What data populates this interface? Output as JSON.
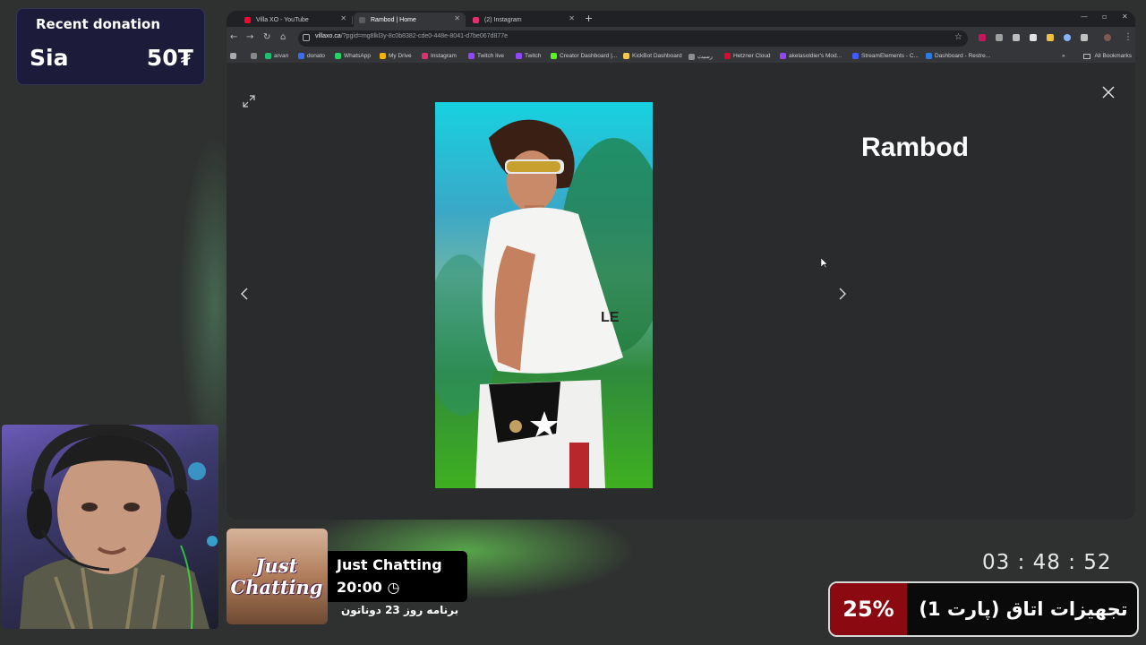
{
  "donation": {
    "title": "Recent donation",
    "donor": "Sia",
    "amount": "50₮"
  },
  "browser": {
    "tabs": [
      {
        "label": "Villa XO - YouTube",
        "color": "#ff0033"
      },
      {
        "label": "Rambod | Home",
        "color": "#5c5c5c"
      },
      {
        "label": "(2) Instagram",
        "color": "#e1306c"
      }
    ],
    "url_host": "villaxo.ca",
    "url_path": "/?pgid=mg8lkl3y-8c0b8382-cde0-448e-8041-d7be067d877e",
    "bookmarks": [
      {
        "label": "arvan",
        "color": "#1dbf73"
      },
      {
        "label": "donato",
        "color": "#3a6df0"
      },
      {
        "label": "WhatsApp",
        "color": "#25d366"
      },
      {
        "label": "My Drive",
        "color": "#f4b400"
      },
      {
        "label": "Instagram",
        "color": "#e1306c"
      },
      {
        "label": "Twitch live",
        "color": "#9146ff"
      },
      {
        "label": "Twitch",
        "color": "#9146ff"
      },
      {
        "label": "Creator Dashboard |...",
        "color": "#53fc18"
      },
      {
        "label": "KickBot Dashboard",
        "color": "#f2c94c"
      },
      {
        "label": "رسیت",
        "color": "#8e8e8e"
      },
      {
        "label": "Hetzner Cloud",
        "color": "#d50c2d"
      },
      {
        "label": "akelasoldier's Mod...",
        "color": "#9146ff"
      },
      {
        "label": "StreamElements - C...",
        "color": "#3c5cff"
      },
      {
        "label": "Dashboard - Restre...",
        "color": "#2a7de1"
      }
    ],
    "all_bookmarks": "All Bookmarks"
  },
  "viewer": {
    "profile_name": "Rambod",
    "photo_text": "LE"
  },
  "category": {
    "logo": "Just Chatting",
    "name": "Just Chatting",
    "time": "20:00",
    "schedule": "برنامه روز 23 دوناتون"
  },
  "clock": "03 : 48 : 52",
  "goal": {
    "percent": "25%",
    "title": "تجهیزات اتاق (پارت 1)"
  }
}
